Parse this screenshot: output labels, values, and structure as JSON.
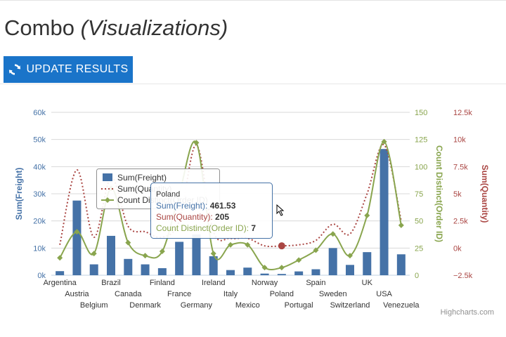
{
  "page": {
    "title_main": "Combo",
    "title_sub": "(Visualizations)",
    "update_button_label": "UPDATE RESULTS",
    "update_icon": "refresh-icon",
    "credits": "Highcharts.com"
  },
  "tooltip": {
    "header": "Poland",
    "rows": [
      {
        "label": "Sum(Freight): ",
        "value": "461.53",
        "color": "#4572a7"
      },
      {
        "label": "Sum(Quantity): ",
        "value": "205",
        "color": "#aa4643"
      },
      {
        "label": "Count Distinct(Order ID): ",
        "value": "7",
        "color": "#89a54e"
      }
    ]
  },
  "colors": {
    "freight": "#4572a7",
    "quantity": "#aa4643",
    "count": "#89a54e",
    "button": "#1a74c9"
  },
  "chart_data": {
    "type": "bar",
    "categories": [
      "Argentina",
      "Austria",
      "Belgium",
      "Brazil",
      "Canada",
      "Denmark",
      "Finland",
      "France",
      "Germany",
      "Ireland",
      "Italy",
      "Mexico",
      "Norway",
      "Poland",
      "Portugal",
      "Spain",
      "Sweden",
      "Switzerland",
      "UK",
      "USA",
      "Venezuela"
    ],
    "series": [
      {
        "name": "Sum(Freight)",
        "type": "bar",
        "axis": "left",
        "values": [
          1500,
          27500,
          4000,
          14500,
          6000,
          4000,
          2600,
          12300,
          15000,
          7000,
          1900,
          2800,
          600,
          461.53,
          1400,
          2200,
          10000,
          3800,
          8500,
          46500,
          7700
        ]
      },
      {
        "name": "Sum(Quantity)",
        "type": "line-dotted",
        "axis": "right-outer",
        "values": [
          300,
          7200,
          1000,
          6500,
          2000,
          1500,
          1000,
          2500,
          9500,
          1500,
          900,
          900,
          200,
          205,
          300,
          700,
          2200,
          1300,
          5000,
          9500,
          2500
        ]
      },
      {
        "name": "Count Distinct(Order ID)",
        "type": "line",
        "axis": "right-inner",
        "values": [
          16,
          40,
          20,
          80,
          30,
          18,
          22,
          75,
          122,
          20,
          28,
          28,
          7,
          7,
          14,
          23,
          38,
          18,
          55,
          123,
          46
        ]
      }
    ],
    "axes": {
      "left": {
        "title": "Sum(Freight)",
        "ylim": [
          0,
          60000
        ],
        "ticks": [
          "0k",
          "10k",
          "20k",
          "30k",
          "40k",
          "50k",
          "60k"
        ]
      },
      "right_inner": {
        "title": "Count Distinct(Order ID)",
        "ylim": [
          0,
          150
        ],
        "ticks": [
          "0",
          "25",
          "50",
          "75",
          "100",
          "125",
          "150"
        ]
      },
      "right_outer": {
        "title": "Sum(Quantity)",
        "ylim": [
          -2500,
          12500
        ],
        "ticks": [
          "−2.5k",
          "0k",
          "2.5k",
          "5k",
          "7.5k",
          "10k",
          "12.5k"
        ]
      }
    },
    "legend": {
      "placement": "top-left",
      "entries": [
        "Sum(Freight)",
        "Sum(Quantity)",
        "Count Distinct(Order ID)"
      ]
    },
    "highlight_category": "Poland"
  }
}
